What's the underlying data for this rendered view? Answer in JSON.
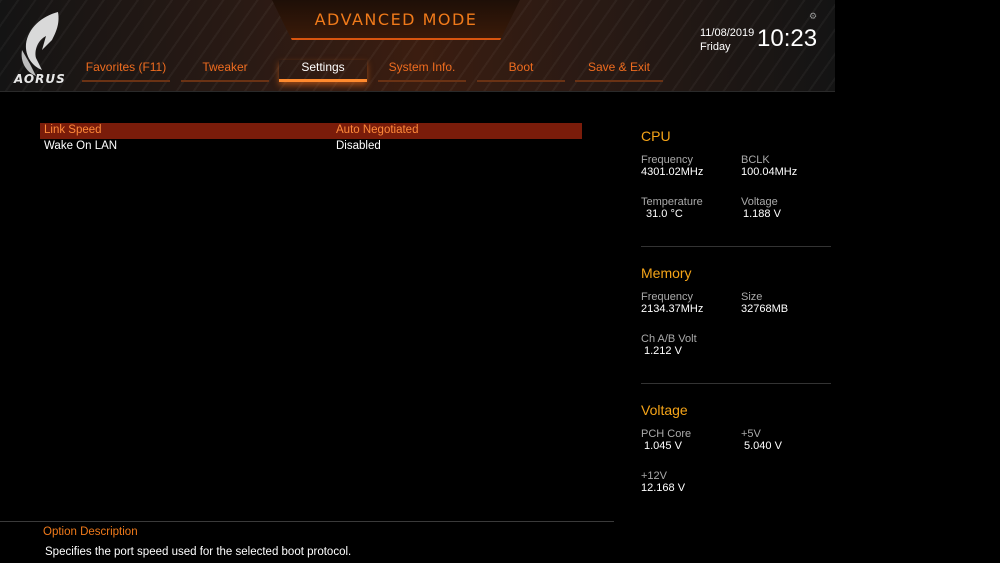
{
  "header": {
    "logo_text": "AORUS",
    "logo_icon": "aorus-falcon-icon",
    "mode_title": "ADVANCED MODE",
    "tabs": [
      {
        "label": "Favorites (F11)"
      },
      {
        "label": "Tweaker"
      },
      {
        "label": "Settings",
        "active": true
      },
      {
        "label": "System Info."
      },
      {
        "label": "Boot"
      },
      {
        "label": "Save & Exit"
      }
    ],
    "date": "11/08/2019",
    "day": "Friday",
    "time": "10:23",
    "gear_icon": "gear-icon"
  },
  "main": {
    "rows": [
      {
        "label": "Link Speed",
        "value": "Auto Negotiated",
        "selected": true
      },
      {
        "label": "Wake On LAN",
        "value": "Disabled",
        "selected": false
      }
    ]
  },
  "panel": {
    "cpu": {
      "title": "CPU",
      "frequency_label": "Frequency",
      "frequency_value": "4301.02MHz",
      "bclk_label": "BCLK",
      "bclk_value": "100.04MHz",
      "temperature_label": "Temperature",
      "temperature_value": "31.0 °C",
      "voltage_label": "Voltage",
      "voltage_value": "1.188 V"
    },
    "memory": {
      "title": "Memory",
      "frequency_label": "Frequency",
      "frequency_value": "2134.37MHz",
      "size_label": "Size",
      "size_value": "32768MB",
      "chvolt_label": "Ch A/B Volt",
      "chvolt_value": "1.212 V"
    },
    "voltage": {
      "title": "Voltage",
      "pch_label": "PCH Core",
      "pch_value": "1.045 V",
      "v5_label": "+5V",
      "v5_value": "5.040 V",
      "v12_label": "+12V",
      "v12_value": "12.168 V"
    }
  },
  "footer": {
    "title": "Option Description",
    "text": "Specifies the port speed used for the selected boot protocol."
  },
  "colors": {
    "accent": "#f07a1a",
    "section_title": "#f5a418",
    "selected_row_bg": "#7a1c0a"
  }
}
